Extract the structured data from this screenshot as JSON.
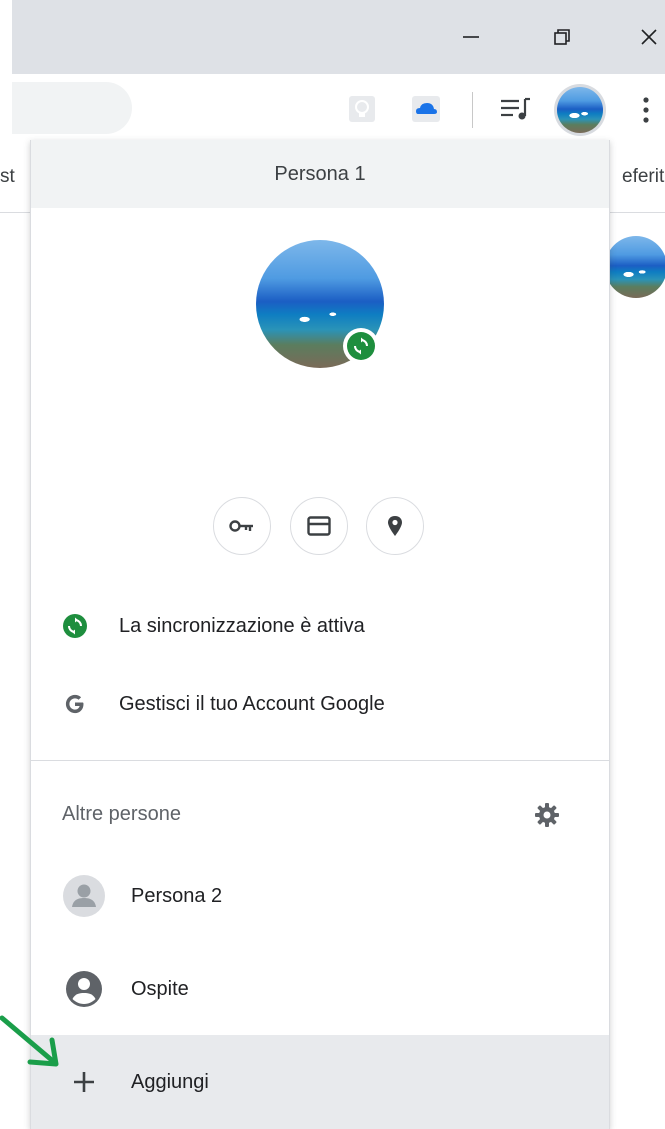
{
  "window": {
    "minimize_icon": "minimize-icon",
    "restore_icon": "restore-icon",
    "close_icon": "close-icon"
  },
  "toolbar": {
    "icons": [
      "lightbulb-extension-icon",
      "cloud-extension-icon",
      "media-controls-icon",
      "profile-avatar",
      "more-menu-icon"
    ]
  },
  "bookmarks": {
    "left_fragment": "st",
    "right_fragment": "eferiti"
  },
  "profile_menu": {
    "header": "Persona 1",
    "quick_actions": [
      "password-key-icon",
      "payment-card-icon",
      "address-pin-icon"
    ],
    "sync_status": "La sincronizzazione è attiva",
    "manage_account": "Gestisci il tuo Account Google",
    "others_heading": "Altre persone",
    "others": [
      {
        "label": "Persona 2"
      },
      {
        "label": "Ospite"
      }
    ],
    "add_label": "Aggiungi"
  },
  "colors": {
    "sync_green": "#1e8e3e",
    "annotation_arrow": "#1a9e4a",
    "hover_row": "#e8eaed"
  }
}
